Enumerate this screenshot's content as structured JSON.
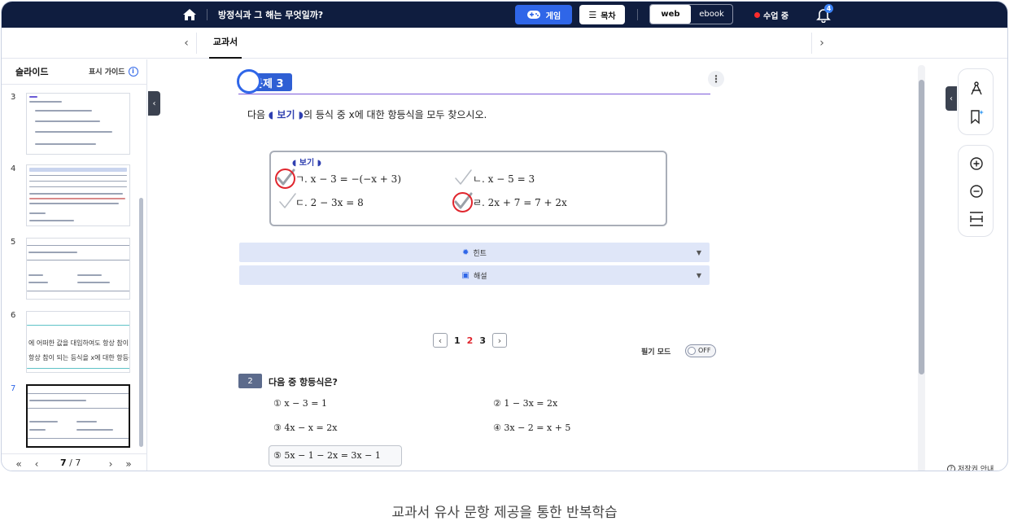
{
  "topbar": {
    "title": "방정식과 그 해는 무엇일까?",
    "game_label": "게임",
    "toc_label": "목차",
    "view_web": "web",
    "view_ebook": "ebook",
    "live_label": "수업 중",
    "notification_count": "4",
    "home_icon": "home-icon",
    "bell_icon": "bell-icon"
  },
  "tabs": {
    "active": "교과서"
  },
  "sidebar": {
    "title": "슬라이드",
    "guide_label": "표시 가이드",
    "slides": [
      {
        "num": "3"
      },
      {
        "num": "4"
      },
      {
        "num": "5"
      },
      {
        "num": "6",
        "line1": "에 어떠한 값을 대입하여도 항상 참이 된",
        "line2": "항상 참이 되는 등식을 x에 대한 항등식"
      },
      {
        "num": "7"
      }
    ],
    "page_current": "7",
    "page_total": "/ 7"
  },
  "problem": {
    "badge": "문제 3",
    "prompt_before": "다음 ",
    "bogi": "◖ 보기 ◗",
    "prompt_after": "의 등식 중 x에 대한 항등식을 모두 찾으시오.",
    "box_label": "◖ 보기 ◗",
    "choices": [
      {
        "text": "ㄱ. x − 3 = −(−x + 3)",
        "circled": true
      },
      {
        "text": "ㄴ. x − 5 = 3",
        "circled": false
      },
      {
        "text": "ㄷ. 2 − 3x = 8",
        "circled": false
      },
      {
        "text": "ㄹ. 2x + 7 = 7 + 2x",
        "circled": true
      }
    ],
    "hint_label": "힌트",
    "solution_label": "해설"
  },
  "pager": {
    "pages": [
      "1",
      "2",
      "3"
    ],
    "current": "2"
  },
  "note_mode": {
    "label": "필기 모드",
    "state": "OFF"
  },
  "question2": {
    "num": "2",
    "text": "다음 중 항등식은?",
    "options": [
      {
        "mark": "①",
        "expr": "x − 3 = 1"
      },
      {
        "mark": "②",
        "expr": "1 − 3x = 2x"
      },
      {
        "mark": "③",
        "expr": "4x − x = 2x"
      },
      {
        "mark": "④",
        "expr": "3x − 2 = x + 5"
      },
      {
        "mark": "⑤",
        "expr": "5x − 1 − 2x = 3x − 1"
      }
    ],
    "selected": "⑤"
  },
  "right_tools": [
    "compass-icon",
    "bookmark-icon",
    "zoom-in-icon",
    "zoom-out-icon",
    "fit-height-icon"
  ],
  "copyright_label": "저작권 안내",
  "caption": "교과서 유사 문항 제공을 통한 반복학습",
  "colors": {
    "topbar": "#0f1d3f",
    "accent": "#2f66e8",
    "mark_red": "#e0262e"
  }
}
